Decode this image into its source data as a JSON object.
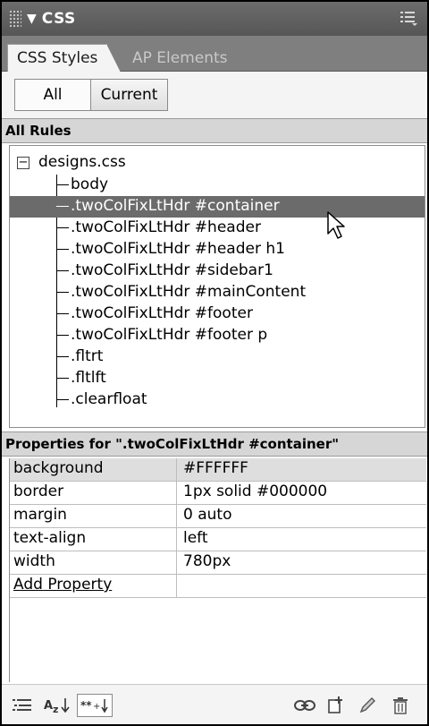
{
  "panel": {
    "title": "CSS",
    "collapse_glyph": "▼"
  },
  "tabs": [
    {
      "label": "CSS Styles",
      "active": true
    },
    {
      "label": "AP Elements",
      "active": false
    }
  ],
  "view_toggle": {
    "all": "All",
    "current": "Current",
    "selected": "All"
  },
  "rules_section": {
    "header": "All Rules",
    "stylesheet": "designs.css",
    "expander": "−",
    "rules": [
      "body",
      ".twoColFixLtHdr #container",
      ".twoColFixLtHdr #header",
      ".twoColFixLtHdr #header h1",
      ".twoColFixLtHdr #sidebar1",
      ".twoColFixLtHdr #mainContent",
      ".twoColFixLtHdr #footer",
      ".twoColFixLtHdr #footer p",
      ".fltrt",
      ".fltlft",
      ".clearfloat"
    ],
    "selected_rule": ".twoColFixLtHdr #container"
  },
  "properties_section": {
    "header": "Properties for \".twoColFixLtHdr #container\"",
    "properties": [
      {
        "name": "background",
        "value": "#FFFFFF"
      },
      {
        "name": "border",
        "value": "1px solid #000000"
      },
      {
        "name": "margin",
        "value": "0 auto"
      },
      {
        "name": "text-align",
        "value": "left"
      },
      {
        "name": "width",
        "value": "780px"
      }
    ],
    "add_property": "Add Property"
  },
  "toolbar": {
    "left_icons": [
      "category-view-icon",
      "alphabetical-view-icon",
      "set-properties-view-icon"
    ],
    "right_icons": [
      "attach-stylesheet-icon",
      "new-css-rule-icon",
      "edit-style-icon",
      "delete-css-rule-icon"
    ]
  },
  "colors": {
    "titlebar": "#5f5f5f",
    "tabbar": "#7f7f7f",
    "selected_row": "#6b6b6b",
    "section_header": "#d6d6d6"
  }
}
